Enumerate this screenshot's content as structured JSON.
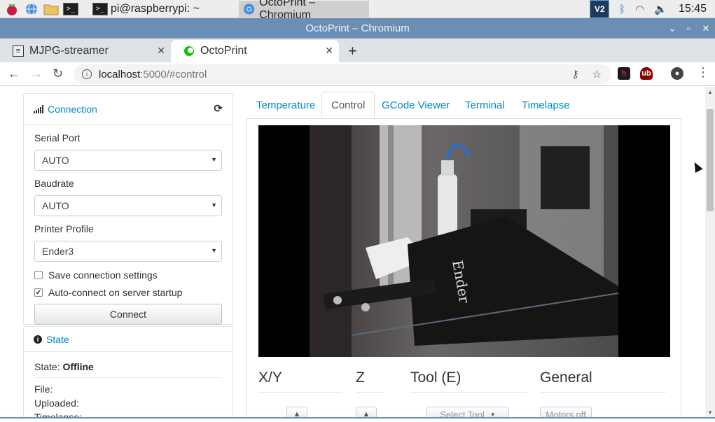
{
  "taskbar": {
    "task_terminal": "pi@raspberrypi: ~",
    "task_browser": "OctoPrint – Chromium",
    "vnc_label": "V2",
    "clock": "15:45"
  },
  "window": {
    "title": "OctoPrint – Chromium"
  },
  "browser": {
    "tabs": [
      {
        "label": "MJPG-streamer"
      },
      {
        "label": "OctoPrint"
      }
    ],
    "url_host": "localhost",
    "url_rest": ":5000/#control"
  },
  "connection": {
    "title": "Connection",
    "serial_port_label": "Serial Port",
    "serial_port_value": "AUTO",
    "baudrate_label": "Baudrate",
    "baudrate_value": "AUTO",
    "printer_profile_label": "Printer Profile",
    "printer_profile_value": "Ender3",
    "save_settings_label": "Save connection settings",
    "save_settings_checked": false,
    "autoconnect_label": "Auto-connect on server startup",
    "autoconnect_checked": true,
    "connect_button": "Connect"
  },
  "state": {
    "title": "State",
    "state_label": "State:",
    "state_value": "Offline",
    "file_label": "File:",
    "uploaded_label": "Uploaded:",
    "timelapse_label": "Timelapse:",
    "timelapse_value": "-"
  },
  "tabs": [
    "Temperature",
    "Control",
    "GCode Viewer",
    "Terminal",
    "Timelapse"
  ],
  "control": {
    "xy_heading": "X/Y",
    "z_heading": "Z",
    "tool_heading": "Tool (E)",
    "general_heading": "General",
    "select_tool": "Select Tool",
    "motors_off": "Motors off"
  },
  "colors": {
    "link": "#0088cc",
    "titlebar": "#6b8fb4"
  }
}
